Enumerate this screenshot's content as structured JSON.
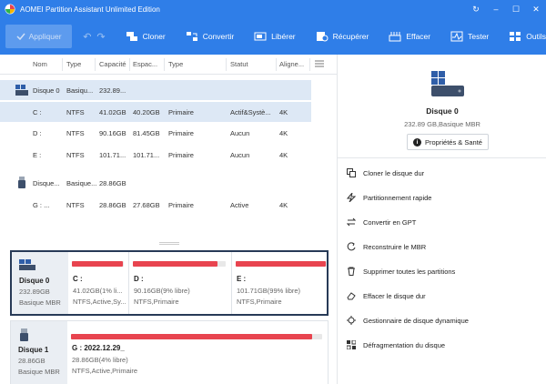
{
  "window": {
    "title": "AOMEI Partition Assistant Unlimited Edition",
    "controls": [
      "↻",
      "–",
      "☐",
      "✕"
    ]
  },
  "toolbar": {
    "apply_label": "Appliquer",
    "items": [
      {
        "label": "Cloner",
        "icon": "clone-icon"
      },
      {
        "label": "Convertir",
        "icon": "convert-icon"
      },
      {
        "label": "Libérer",
        "icon": "free-icon"
      },
      {
        "label": "Récupérer",
        "icon": "recover-icon"
      },
      {
        "label": "Effacer",
        "icon": "wipe-icon"
      },
      {
        "label": "Tester",
        "icon": "test-icon"
      },
      {
        "label": "Outils",
        "icon": "tools-icon"
      }
    ]
  },
  "table": {
    "headers": [
      "Nom",
      "Type",
      "Capacité",
      "Espac...",
      "Type",
      "Statut",
      "Aligne..."
    ],
    "rows": [
      {
        "kind": "disk",
        "name": "Disque 0",
        "type": "Basiqu...",
        "capacity": "232.89...",
        "free": "",
        "ptype": "",
        "status": "",
        "align": "",
        "selected": true
      },
      {
        "kind": "part",
        "name": "C :",
        "type": "NTFS",
        "capacity": "41.02GB",
        "free": "40.20GB",
        "ptype": "Primaire",
        "status": "Actif&Systè...",
        "align": "4K",
        "selected": true
      },
      {
        "kind": "part",
        "name": "D :",
        "type": "NTFS",
        "capacity": "90.16GB",
        "free": "81.45GB",
        "ptype": "Primaire",
        "status": "Aucun",
        "align": "4K",
        "selected": false
      },
      {
        "kind": "part",
        "name": "E :",
        "type": "NTFS",
        "capacity": "101.71...",
        "free": "101.71...",
        "ptype": "Primaire",
        "status": "Aucun",
        "align": "4K",
        "selected": false
      },
      {
        "kind": "disk",
        "name": "Disque...",
        "type": "Basique...",
        "capacity": "28.86GB",
        "free": "",
        "ptype": "",
        "status": "",
        "align": "",
        "selected": false
      },
      {
        "kind": "part",
        "name": "G : ...",
        "type": "NTFS",
        "capacity": "28.86GB",
        "free": "27.68GB",
        "ptype": "Primaire",
        "status": "Active",
        "align": "4K",
        "selected": false
      }
    ]
  },
  "diskmap": [
    {
      "name": "Disque 0",
      "size": "232.89GB",
      "type": "Basique MBR",
      "active": true,
      "partitions": [
        {
          "name": "C :",
          "size": "41.02GB(1% li...",
          "fs": "NTFS,Active,Sy...",
          "used": 0.98
        },
        {
          "name": "D :",
          "size": "90.16GB(9% libre)",
          "fs": "NTFS,Primaire",
          "used": 0.91
        },
        {
          "name": "E :",
          "size": "101.71GB(99% libre)",
          "fs": "NTFS,Primaire",
          "used": 0.99
        }
      ]
    },
    {
      "name": "Disque 1",
      "size": "28.86GB",
      "type": "Basique MBR",
      "active": false,
      "partitions": [
        {
          "name": "G : 2022.12.29_",
          "size": "28.86GB(4% libre)",
          "fs": "NTFS,Active,Primaire",
          "used": 0.96
        }
      ]
    }
  ],
  "details": {
    "disk_name": "Disque 0",
    "disk_info": "232.89 GB,Basique MBR",
    "props_label": "Propriétés & Santé",
    "operations": [
      {
        "label": "Cloner le disque dur",
        "icon": "clone-disk-icon"
      },
      {
        "label": "Partitionnement rapide",
        "icon": "lightning-icon"
      },
      {
        "label": "Convertir en GPT",
        "icon": "convert-arrows-icon"
      },
      {
        "label": "Reconstruire le MBR",
        "icon": "rebuild-icon"
      },
      {
        "label": "Supprimer toutes les partitions",
        "icon": "trash-icon"
      },
      {
        "label": "Effacer le disque dur",
        "icon": "eraser-icon"
      },
      {
        "label": "Gestionnaire de disque dynamique",
        "icon": "dynamic-disk-icon"
      },
      {
        "label": "Défragmentation du disque",
        "icon": "defrag-icon"
      }
    ]
  },
  "colors": {
    "accent": "#2f7ee8",
    "used_bar": "#e8444f",
    "selected_row": "#dde8f5",
    "disk_panel": "#eaeef3",
    "active_border": "#273a57"
  }
}
